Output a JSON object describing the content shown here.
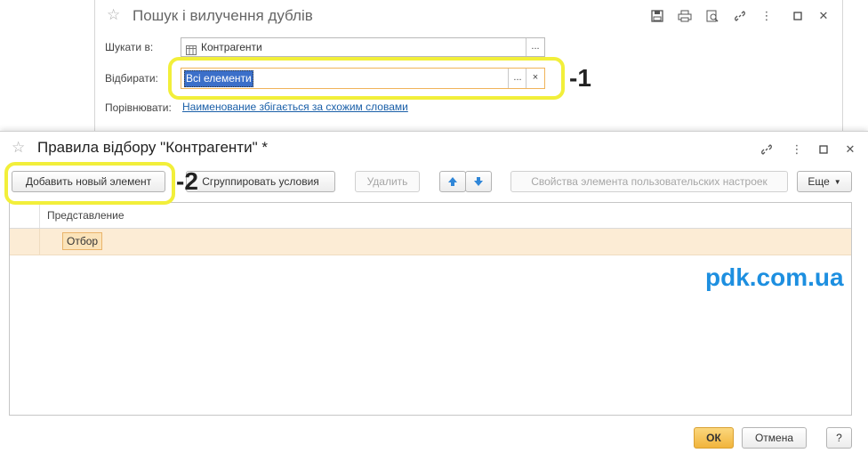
{
  "bg_window": {
    "title": "Пошук і вилучення дублів",
    "search_label": "Шукати в:",
    "search_value": "Контрагенти",
    "select_label": "Відбирати:",
    "select_value": "Всі елементи",
    "compare_label": "Порівнювати:",
    "compare_link": "Наименование збігається за схожим словами",
    "ellipsis": "...",
    "clear": "×"
  },
  "markers": {
    "one": "-1",
    "two": "-2"
  },
  "dialog": {
    "title": "Правила відбору \"Контрагенти\" *",
    "toolbar": {
      "add": "Добавить новый элемент",
      "group": "Сгруппировать условия",
      "delete": "Удалить",
      "props": "Свойства элемента пользовательских настроек",
      "more": "Еще"
    },
    "grid": {
      "column_header": "Представление",
      "rows": [
        {
          "label": "Отбор"
        }
      ]
    },
    "footer": {
      "ok": "ОК",
      "cancel": "Отмена",
      "help": "?"
    }
  },
  "watermark": "pdk.com.ua",
  "colors": {
    "highlight": "#f2ef3a",
    "accent": "#f1b43c",
    "link": "#1a5fa8",
    "watermark": "#1d8fe0"
  }
}
